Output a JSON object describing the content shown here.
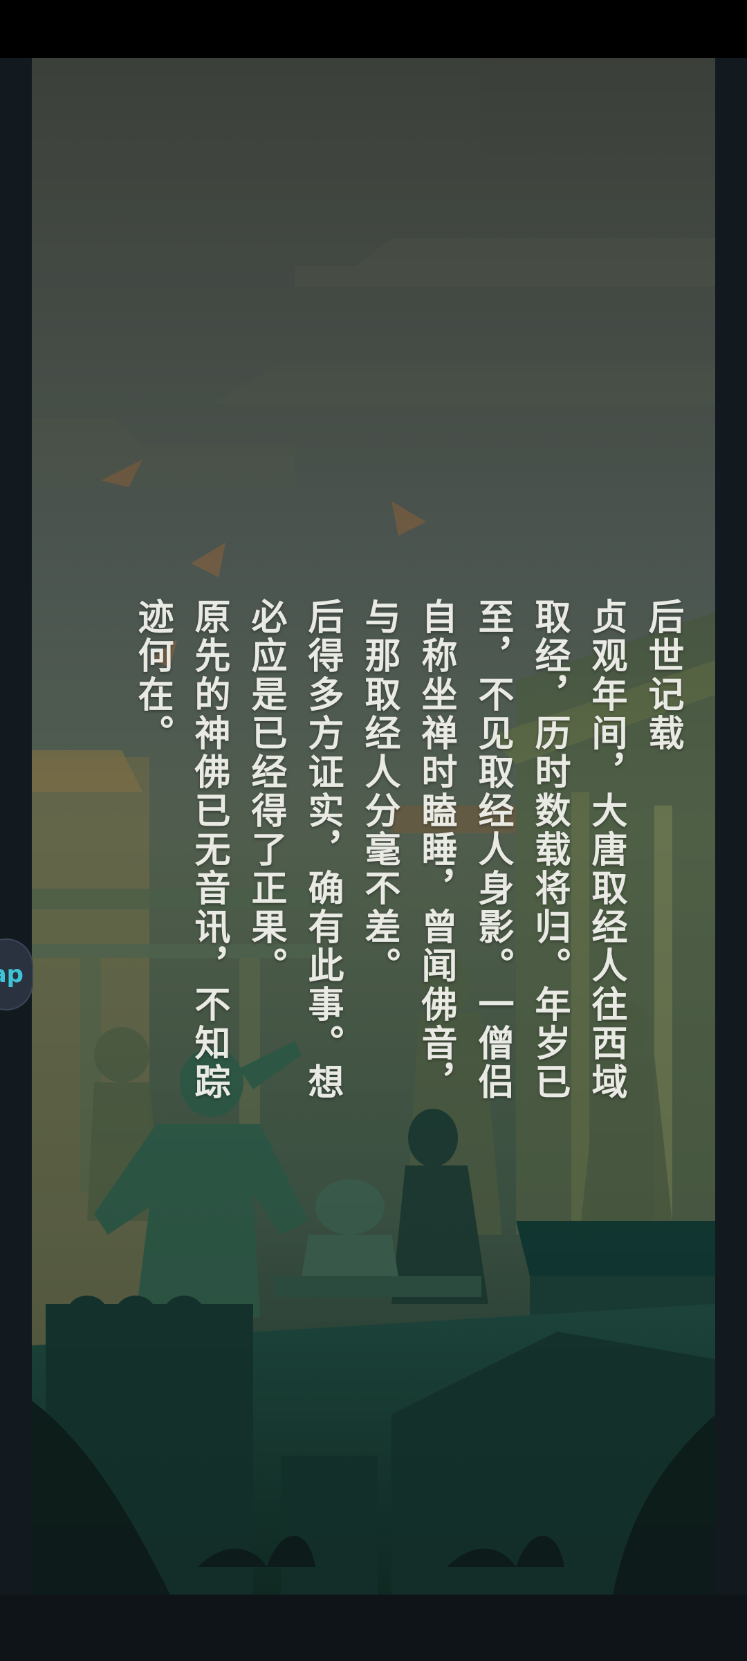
{
  "story": {
    "title": "后世记载",
    "lines": [
      "贞观年间，大唐取经人往西域",
      "取经，历时数载将归。年岁已",
      "至，不见取经人身影。一僧侣",
      "自称坐禅时瞌睡，曾闻佛音，",
      "与那取经人分毫不差。",
      "后得多方证实，确有此事。想",
      "必应是已经得了正果。",
      "原先的神佛已无音讯，不知踪",
      "迹何在。"
    ]
  },
  "side_button": {
    "label": "ap",
    "icon": "side-tab-icon"
  },
  "colors": {
    "text": "#eaeae4",
    "status_bar": "#000000",
    "frame": "#121a1f",
    "button_text": "#3fc4d6"
  }
}
